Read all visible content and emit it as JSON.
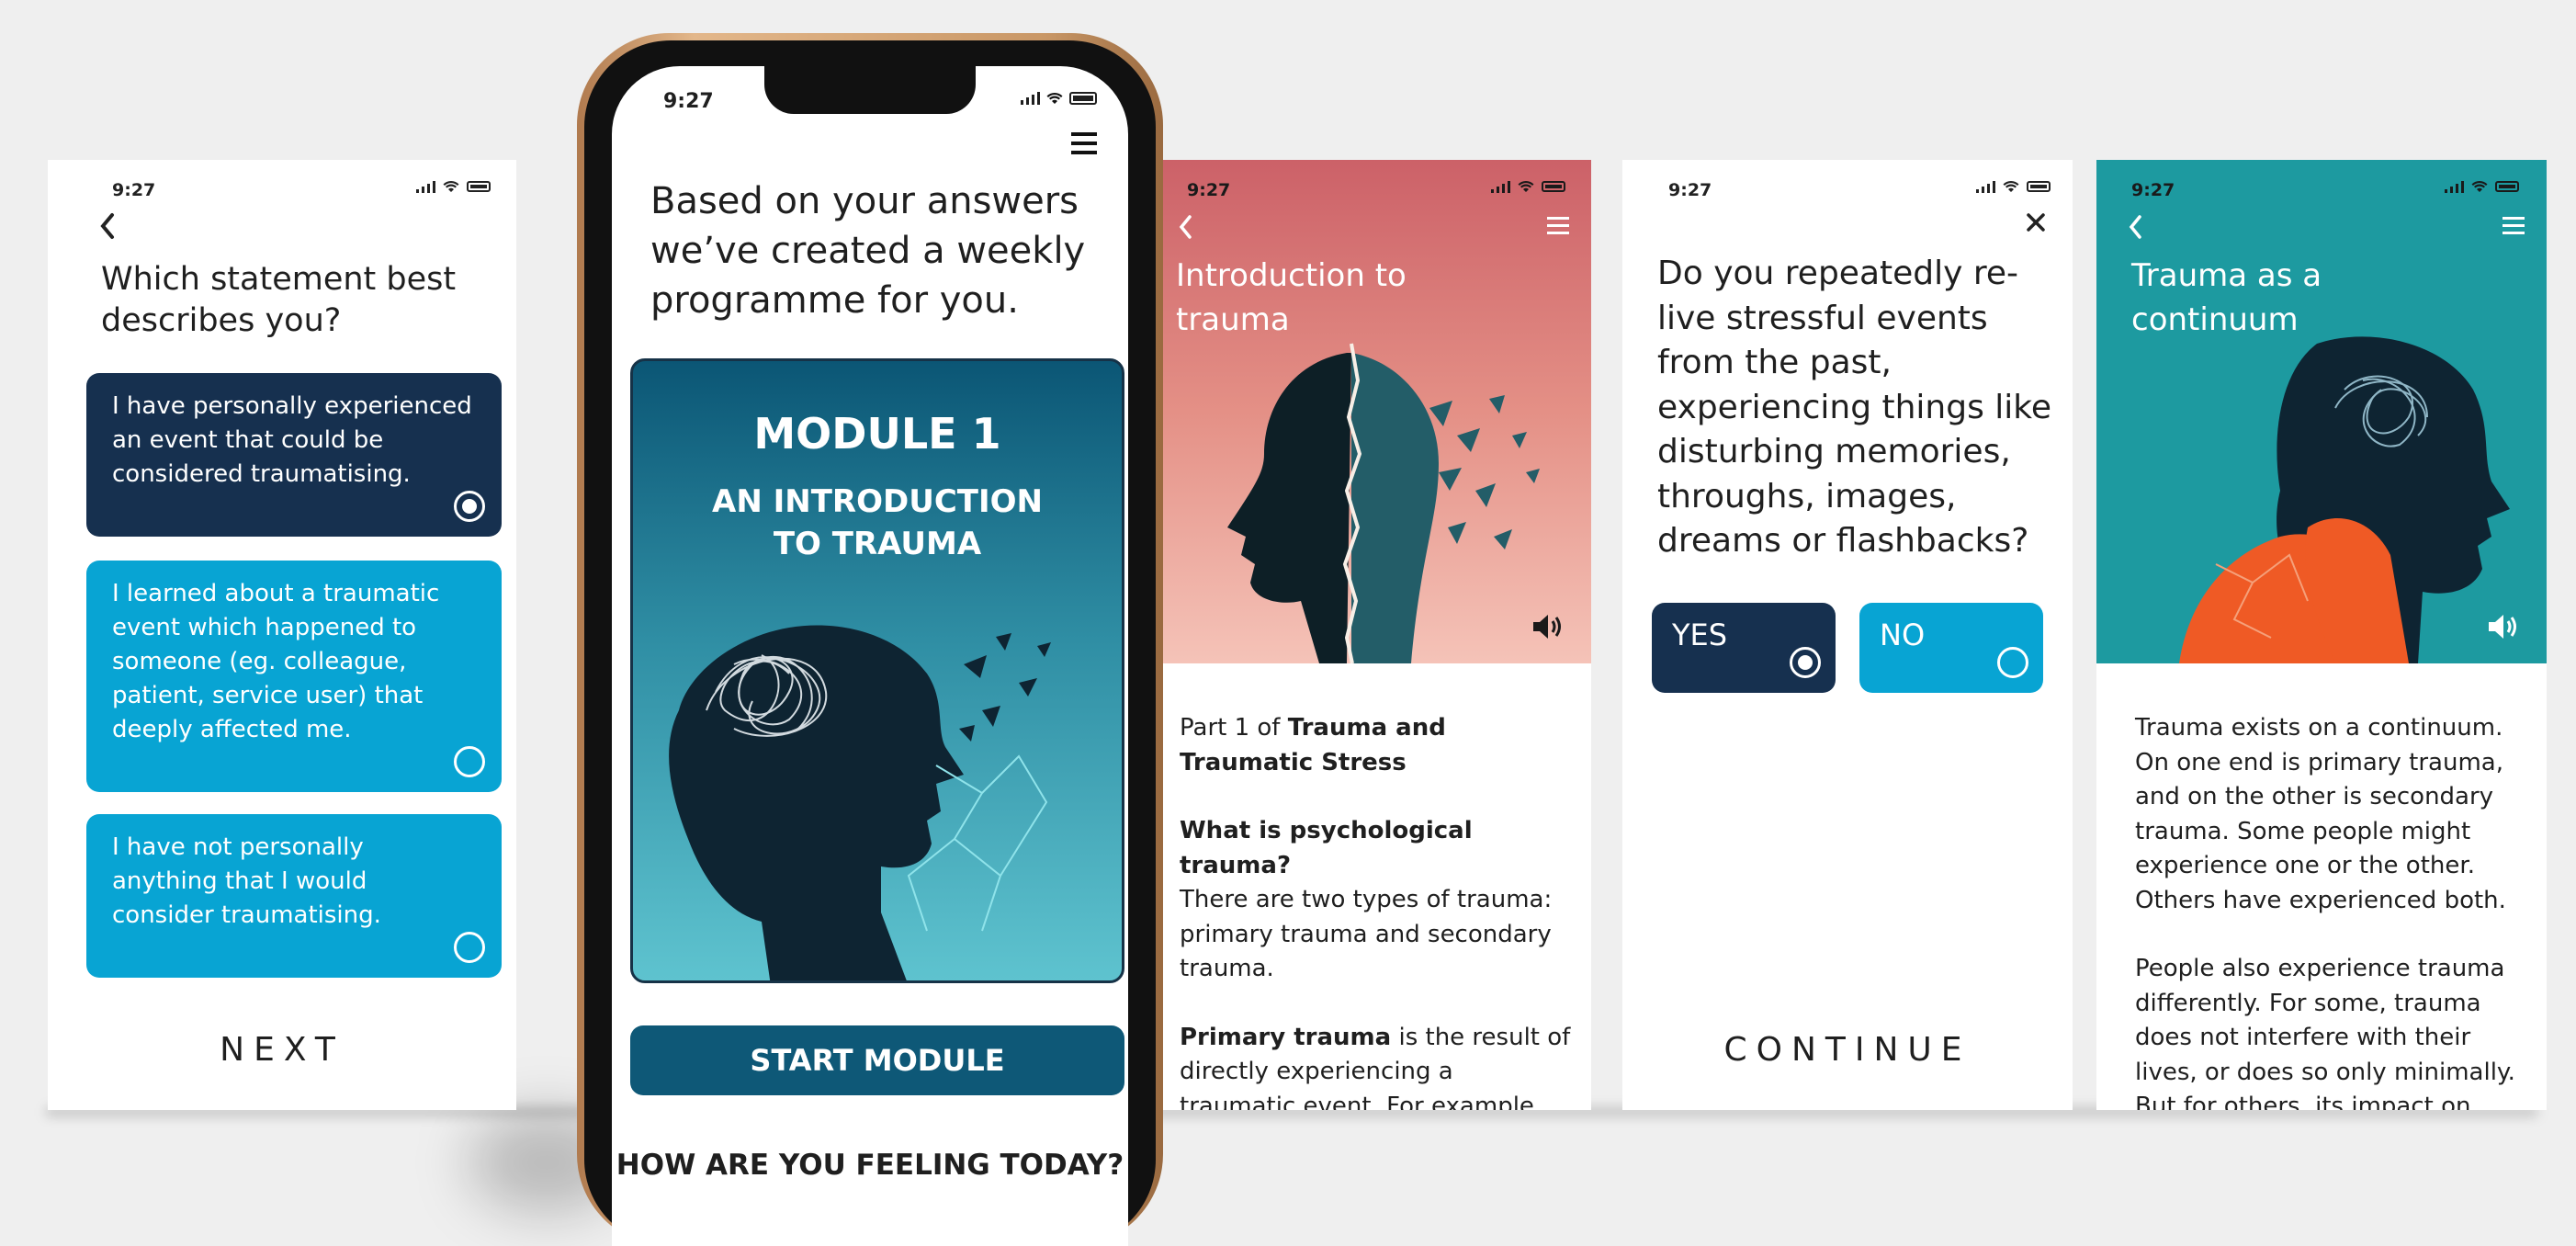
{
  "colors": {
    "navy": "#16304f",
    "cyan": "#08a4d3",
    "teal": "#1d9aa0",
    "coral_top": "#cc6168",
    "coral_bottom": "#f5c3b8",
    "module_top": "#0b5675",
    "module_bottom": "#5ec3cf",
    "orange": "#ef5a25"
  },
  "screen1": {
    "time": "9:27",
    "back_icon": "back-chevron-icon",
    "title": "Which statement best describes you?",
    "options": [
      {
        "text": "I have personally experienced an event that could be considered traumatising.",
        "selected": true
      },
      {
        "text": "I learned about a traumatic event which happened to someone (eg. colleague, patient, service user) that deeply affected me.",
        "selected": false
      },
      {
        "text": "I have not personally anything that I would consider traumatising.",
        "selected": false
      }
    ],
    "next_label": "NEXT"
  },
  "phone": {
    "time": "9:27",
    "menu_icon": "hamburger-menu-icon",
    "heading": "Based on your answers we’ve created a weekly programme for you.",
    "module_label": "MODULE 1",
    "module_title": "AN INTRODUCTION TO TRAUMA",
    "start_label": "START MODULE",
    "feeling_label": "HOW ARE YOU FEELING TODAY?"
  },
  "screen3": {
    "time": "9:27",
    "title": "Introduction to trauma",
    "audio_icon": "speaker-icon",
    "part_prefix": "Part 1 of ",
    "part_bold": "Trauma and Traumatic Stress",
    "q_heading": "What is psychological trauma?",
    "q_text": "There are two types of trauma: primary trauma and secondary trauma.",
    "primary_bold": "Primary trauma",
    "primary_text": " is the result of directly experiencing a traumatic event. For example, witnessing the result of a"
  },
  "screen4": {
    "time": "9:27",
    "close_icon": "close-icon",
    "question": "Do you repeatedly re-live stressful events from the past, experiencing things like disturbing memories, throughs, images, dreams or flashbacks?",
    "yes_label": "YES",
    "no_label": "NO",
    "yes_selected": true,
    "continue_label": "CONTINUE"
  },
  "screen5": {
    "time": "9:27",
    "title": "Trauma as a continuum",
    "audio_icon": "speaker-icon",
    "para1": "Trauma exists on a continuum. On one end is primary trauma, and on the other is secondary trauma. Some people might experience one or the other. Others have experienced both.",
    "para2": "People also experience trauma differently. For some, trauma does not interfere with their lives, or does so only minimally. But for others, its impact on"
  }
}
